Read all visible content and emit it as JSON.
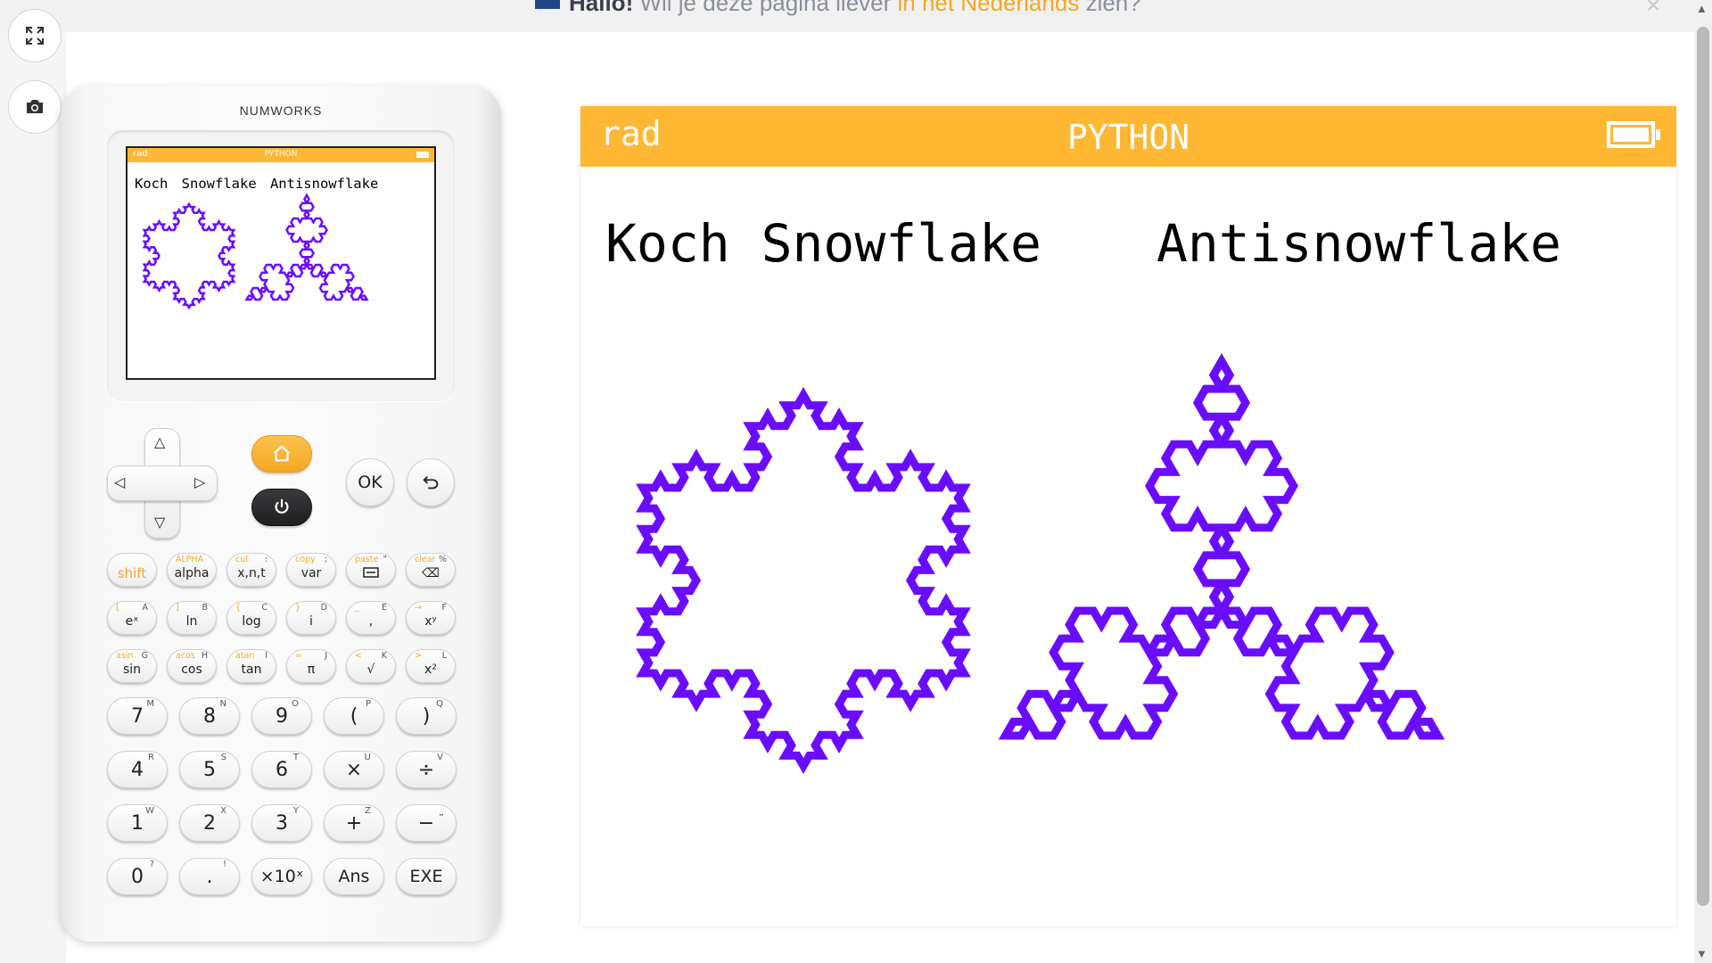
{
  "banner": {
    "greeting": "Hallo!",
    "text_before": "Wil je deze pagina liever",
    "link": "in het Nederlands",
    "text_after": "zien?",
    "close": "×",
    "flag_color": "#21468b"
  },
  "sidebar": {
    "fullscreen_icon": "fullscreen-icon",
    "screenshot_icon": "camera-icon"
  },
  "calculator": {
    "brand": "NUMWORKS",
    "mini_screen": {
      "mode": "rad",
      "app": "PYTHON",
      "title": "Koch Snowflake Antisnowflake"
    },
    "keys": {
      "ok": "OK",
      "row1": [
        {
          "main": "shift",
          "sub": "",
          "sub2": ""
        },
        {
          "main": "alpha",
          "sub": "ALPHA",
          "sub2": ""
        },
        {
          "main": "x,n,t",
          "sub": "cut",
          "sub2": ":"
        },
        {
          "main": "var",
          "sub": "copy",
          "sub2": ";"
        },
        {
          "main": "",
          "sub": "paste",
          "sub2": "\""
        },
        {
          "main": "⌫",
          "sub": "clear",
          "sub2": "%"
        }
      ],
      "row2": [
        {
          "main": "eˣ",
          "sub": "[",
          "sub2": "A"
        },
        {
          "main": "ln",
          "sub": "]",
          "sub2": "B"
        },
        {
          "main": "log",
          "sub": "{",
          "sub2": "C"
        },
        {
          "main": "i",
          "sub": "}",
          "sub2": "D"
        },
        {
          "main": ",",
          "sub": "_",
          "sub2": "E"
        },
        {
          "main": "xʸ",
          "sub": "→",
          "sub2": "F"
        }
      ],
      "row3": [
        {
          "main": "sin",
          "sub": "asin",
          "sub2": "G"
        },
        {
          "main": "cos",
          "sub": "acos",
          "sub2": "H"
        },
        {
          "main": "tan",
          "sub": "atan",
          "sub2": "I"
        },
        {
          "main": "π",
          "sub": "=",
          "sub2": "J"
        },
        {
          "main": "√",
          "sub": "<",
          "sub2": "K"
        },
        {
          "main": "x²",
          "sub": ">",
          "sub2": "L"
        }
      ],
      "row4": [
        {
          "main": "7",
          "sup": "M"
        },
        {
          "main": "8",
          "sup": "N"
        },
        {
          "main": "9",
          "sup": "O"
        },
        {
          "main": "(",
          "sup": "P"
        },
        {
          "main": ")",
          "sup": "Q"
        }
      ],
      "row5": [
        {
          "main": "4",
          "sup": "R"
        },
        {
          "main": "5",
          "sup": "S"
        },
        {
          "main": "6",
          "sup": "T"
        },
        {
          "main": "×",
          "sup": "U"
        },
        {
          "main": "÷",
          "sup": "V"
        }
      ],
      "row6": [
        {
          "main": "1",
          "sup": "W"
        },
        {
          "main": "2",
          "sup": "X"
        },
        {
          "main": "3",
          "sup": "Y"
        },
        {
          "main": "+",
          "sup": "Z"
        },
        {
          "main": "−",
          "sup": "⎵"
        }
      ],
      "row7": [
        {
          "main": "0",
          "sup": "?"
        },
        {
          "main": ".",
          "sup": "!"
        },
        {
          "main": "×10ˣ",
          "sup": ""
        },
        {
          "main": "Ans",
          "sup": ""
        },
        {
          "main": "EXE",
          "sup": ""
        }
      ]
    }
  },
  "screen": {
    "mode": "rad",
    "app": "PYTHON",
    "title_koch": "Koch Snowflake",
    "title_anti": "Antisnowflake",
    "fractal_color": "#6a0dff",
    "bar_color": "#ffb734"
  }
}
